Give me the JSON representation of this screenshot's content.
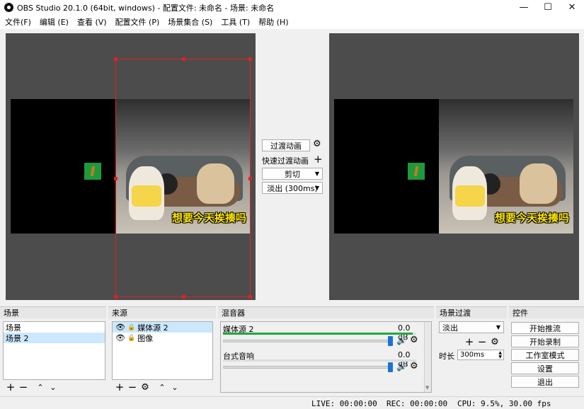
{
  "window": {
    "title": "OBS Studio 20.1.0 (64bit, windows) - 配置文件: 未命名 - 场景: 未命名",
    "minimize": "—",
    "maximize": "☐",
    "close": "✕"
  },
  "menu": [
    "文件(F)",
    "编辑 (E)",
    "查看 (V)",
    "配置文件 (P)",
    "场景集合 (S)",
    "工具 (T)",
    "帮助 (H)"
  ],
  "canvas": {
    "caption": "想要今天挨揍吗"
  },
  "transition": {
    "button": "过渡动画",
    "quick_label": "快速过渡动画",
    "cut_select": "剪切",
    "fade_select": "淡出 (300ms)"
  },
  "scenes": {
    "header": "场景",
    "items": [
      "场景",
      "场景 2"
    ],
    "selected_index": 1
  },
  "sources": {
    "header": "来源",
    "items": [
      "媒体源 2",
      "图像"
    ],
    "selected_index": 0
  },
  "mixer": {
    "header": "混音器",
    "channels": [
      {
        "name": "媒体源 2",
        "db": "0.0 dB",
        "level": 0.98
      },
      {
        "name": "台式音响",
        "db": "0.0 dB",
        "level": 0.0
      }
    ]
  },
  "scene_transition": {
    "header": "场景过渡",
    "select": "淡出",
    "duration_label": "时长",
    "duration_value": "300ms"
  },
  "controls": {
    "header": "控件",
    "buttons": [
      "开始推流",
      "开始录制",
      "工作室模式",
      "设置",
      "退出"
    ]
  },
  "status": {
    "live": "LIVE: 00:00:00",
    "rec": "REC: 00:00:00",
    "cpu": "CPU: 9.5%, 30.00 fps"
  },
  "colors": {
    "canvas_bg": "#4c4c4c",
    "selection": "#dd2222",
    "meter": "#1fa83f",
    "slider": "#1a73d4"
  }
}
